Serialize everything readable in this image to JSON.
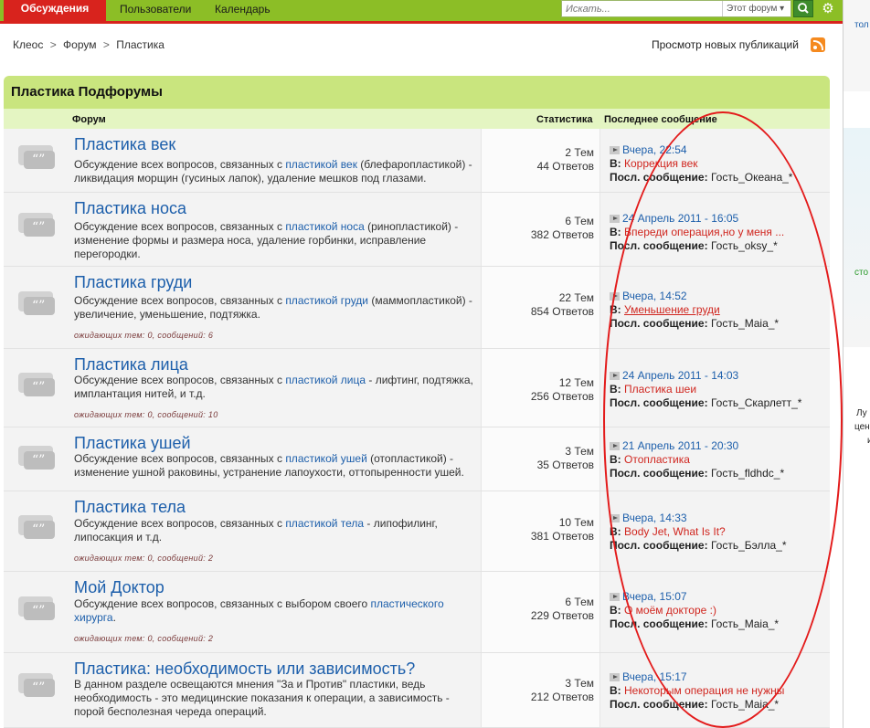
{
  "nav": {
    "tabs": [
      "Обсуждения",
      "Пользователи",
      "Календарь"
    ],
    "search_placeholder": "Искать...",
    "search_scope": "Этот форум"
  },
  "breadcrumb": [
    "Клеос",
    "Форум",
    "Пластика"
  ],
  "new_posts": "Просмотр новых публикаций",
  "block": {
    "title": "Пластика Подфорумы",
    "col_forum": "Форум",
    "col_stats": "Статистика",
    "col_last": "Последнее сообщение"
  },
  "labels": {
    "in": "В:",
    "last_by": "Посл. сообщение:"
  },
  "forums": [
    {
      "name": "Пластика век",
      "desc_pre": "Обсуждение всех вопросов, связанных с ",
      "desc_link": "пластикой век",
      "desc_post": " (блефаропластикой) - ликвидация морщин (гусиных лапок), удаление мешков под глазами.",
      "pending": "",
      "topics": "2 Тем",
      "replies": "44 Ответов",
      "last_date": "Вчера, 22:54",
      "last_topic": "Коррекция век",
      "last_user": "Гость_Океана_*"
    },
    {
      "name": "Пластика носа",
      "desc_pre": "Обсуждение всех вопросов, связанных с ",
      "desc_link": "пластикой носа",
      "desc_post": " (ринопластикой) - изменение формы и размера носа, удаление горбинки, исправление перегородки.",
      "pending": "",
      "topics": "6 Тем",
      "replies": "382 Ответов",
      "last_date": "24 Апрель 2011 - 16:05",
      "last_topic": "Впереди операция,но у меня ...",
      "last_user": "Гость_oksy_*"
    },
    {
      "name": "Пластика груди",
      "desc_pre": "Обсуждение всех вопросов, связанных с ",
      "desc_link": "пластикой груди",
      "desc_post": " (маммопластикой) - увеличение, уменьшение, подтяжка.",
      "pending": "ожидающих тем: 0, сообщений: 6",
      "topics": "22 Тем",
      "replies": "854 Ответов",
      "last_date": "Вчера, 14:52",
      "last_topic": "Уменьшение груди",
      "last_user": "Гость_Maia_*"
    },
    {
      "name": "Пластика лица",
      "desc_pre": "Обсуждение всех вопросов, связанных с ",
      "desc_link": "пластикой лица",
      "desc_post": " - лифтинг, подтяжка, имплантация нитей, и т.д.",
      "pending": "ожидающих тем: 0, сообщений: 10",
      "topics": "12 Тем",
      "replies": "256 Ответов",
      "last_date": "24 Апрель 2011 - 14:03",
      "last_topic": "Пластика шеи",
      "last_user": "Гость_Скарлетт_*"
    },
    {
      "name": "Пластика ушей",
      "desc_pre": "Обсуждение всех вопросов, связанных с ",
      "desc_link": "пластикой ушей",
      "desc_post": " (отопластикой) - изменение ушной раковины, устранение лапоухости, оттопыренности ушей.",
      "pending": "",
      "topics": "3 Тем",
      "replies": "35 Ответов",
      "last_date": "21 Апрель 2011 - 20:30",
      "last_topic": "Отопластика",
      "last_user": "Гость_fldhdc_*"
    },
    {
      "name": "Пластика тела",
      "desc_pre": "Обсуждение всех вопросов, связанных с ",
      "desc_link": "пластикой тела",
      "desc_post": " - липофилинг, липосакция и т.д.",
      "pending": "ожидающих тем: 0, сообщений: 2",
      "topics": "10 Тем",
      "replies": "381 Ответов",
      "last_date": "Вчера, 14:33",
      "last_topic": "Body Jet, What Is It?",
      "last_user": "Гость_Бэлла_*"
    },
    {
      "name": "Мой Доктор",
      "desc_pre": "Обсуждение всех вопросов, связанных с выбором своего ",
      "desc_link": "пластического хирурга",
      "desc_post": ".",
      "pending": "ожидающих тем: 0, сообщений: 2",
      "topics": "6 Тем",
      "replies": "229 Ответов",
      "last_date": "Вчера, 15:07",
      "last_topic": "О моём докторе :)",
      "last_user": "Гость_Maia_*"
    },
    {
      "name": "Пластика: необходимость или зависимость?",
      "desc_pre": "В данном разделе освещаются мнения \"За и Против\" пластики, ведь необходимость - это медицинские показания к операции, а зависимость - порой бесполезная череда операций.",
      "desc_link": "",
      "desc_post": "",
      "pending": "",
      "topics": "3 Тем",
      "replies": "212 Ответов",
      "last_date": "Вчера, 15:17",
      "last_topic": "Некоторым операция не нужны",
      "last_user": "Гость_Maia_*"
    }
  ],
  "right_column": {
    "t1": "тол",
    "t2": "сто",
    "t3": "Лу",
    "t4": "цен",
    "t5": "и"
  },
  "colors": {
    "nav_green": "#8cbe26",
    "nav_red": "#d8231d",
    "header_green": "#c9e57e",
    "link_blue": "#1d5fab",
    "oval_red": "#e31b1b"
  }
}
